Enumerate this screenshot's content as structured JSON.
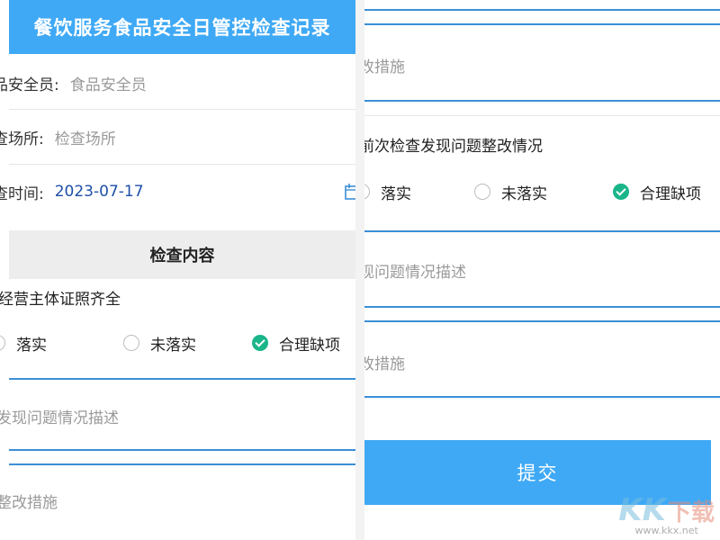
{
  "left": {
    "title": "餐饮服务食品安全日管控检查记录",
    "fields": [
      {
        "label": "品安全员:",
        "value": "食品安全员"
      },
      {
        "label": "查场所:",
        "value": "检查场所"
      },
      {
        "label": "查时间:",
        "value": "2023-07-17"
      }
    ],
    "section_title": "检查内容",
    "question": "经营主体证照齐全",
    "options": [
      "落实",
      "未落实",
      "合理缺项"
    ],
    "selected_option": "合理缺项",
    "placeholder_description": "发现问题情况描述",
    "placeholder_measures": "整改措施"
  },
  "right": {
    "placeholder_measures_top": "改措施",
    "question": "前次检查发现问题整改情况",
    "options": [
      "落实",
      "未落实",
      "合理缺项"
    ],
    "selected_option": "合理缺项",
    "placeholder_description": "现问题情况描述",
    "placeholder_measures": "改措施",
    "submit_label": "提交"
  },
  "watermark": {
    "logo": "KK",
    "logo_zh": "下载",
    "url": "www.kkx.net"
  },
  "colors": {
    "primary": "#3fa9f5",
    "check": "#1bb58a",
    "line": "#3b8fd6",
    "date": "#1d4fa8"
  },
  "icons": {
    "date_field": "calendar-icon",
    "selected": "check-circle-icon"
  }
}
